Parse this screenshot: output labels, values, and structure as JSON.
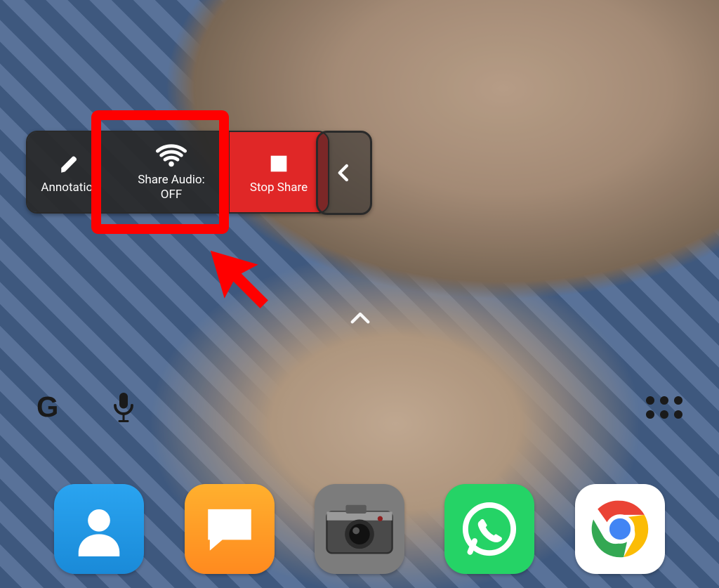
{
  "share_toolbar": {
    "annotation_label": "Annotation",
    "share_audio_label": "Share Audio:",
    "share_audio_state": "OFF",
    "stop_share_label": "Stop Share"
  },
  "dock": {
    "contacts": "Contacts",
    "messages": "Messages",
    "camera": "Camera",
    "whatsapp": "WhatsApp",
    "chrome": "Chrome"
  },
  "annotation": {
    "highlight": "red-box",
    "pointer": "red-arrow"
  }
}
